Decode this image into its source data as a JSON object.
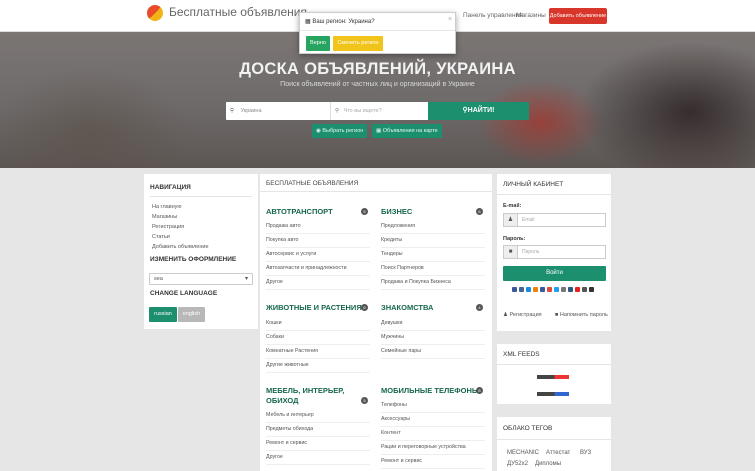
{
  "header": {
    "brand": "Бесплатные объявления",
    "links": [
      "Панель управления",
      "Магазины"
    ],
    "add_button": "Добавить объявление"
  },
  "hero": {
    "title": "ДОСКА ОБЪЯВЛЕНИЙ, УКРАИНА",
    "subtitle": "Поиск объявлений от частных лиц и организаций в Украине",
    "search": {
      "region_value": "Украина",
      "query_placeholder": "Что вы ищете?",
      "button": "НАЙТИ!"
    },
    "buttons": [
      "Выбрать регион",
      "Объявления на карте"
    ]
  },
  "modal": {
    "title": "Ваш регион: Украина?",
    "close": "×",
    "yes": "Верно",
    "change": "Сменить регион"
  },
  "sidebar": {
    "nav_title": "НАВИГАЦИЯ",
    "nav_items": [
      "На главную",
      "Магазины",
      "Регистрация",
      "Статьи",
      "Добавить объявление"
    ],
    "design_title": "ИЗМЕНИТЬ ОФОРМЛЕНИЕ",
    "design_select": "sea",
    "lang_title": "CHANGE LANGUAGE",
    "lang_buttons": [
      "russian",
      "english"
    ]
  },
  "main": {
    "title": "БЕСПЛАТНЫЕ ОБЪЯВЛЕНИЯ",
    "categories": [
      {
        "title": "АВТОТРАНСПОРТ",
        "count": "5",
        "subs": [
          "Продажа авто",
          "Покупка авто",
          "Автосервис и услуги",
          "Автозапчасти и принадлежности",
          "Другое"
        ]
      },
      {
        "title": "БИЗНЕС",
        "count": "6",
        "subs": [
          "Предложения",
          "Кредиты",
          "Тендеры",
          "Поиск Партнеров",
          "Продажа и Покупка Бизнеса"
        ]
      },
      {
        "title": "ЖИВОТНЫЕ И РАСТЕНИЯ",
        "count": "6",
        "subs": [
          "Кошки",
          "Собаки",
          "Комнатные Растения",
          "Другие животные"
        ]
      },
      {
        "title": "ЗНАКОМСТВА",
        "count": "4",
        "subs": [
          "Девушки",
          "Мужчины",
          "Семейные пары"
        ]
      },
      {
        "title": "МЕБЕЛЬ, ИНТЕРЬЕР,",
        "title2": "ОБИХОД",
        "count": "5",
        "subs": [
          "Мебель и интерьер",
          "Предметы обихода",
          "Ремонт и сервис",
          "Другое"
        ]
      },
      {
        "title": "МОБИЛЬНЫЕ ТЕЛЕФОНЫ",
        "count": "8",
        "subs": [
          "Телефоны",
          "Аксессуары",
          "Контент",
          "Рации и переговорные устройства",
          "Ремонт и сервис"
        ]
      }
    ]
  },
  "cabinet": {
    "title": "ЛИЧНЫЙ КАБИНЕТ",
    "email_label": "E-mail:",
    "email_placeholder": "Email",
    "password_label": "Пароль:",
    "password_placeholder": "Пароль",
    "login": "Войти",
    "register": "Регистрация",
    "forgot": "Напомнить пароль"
  },
  "xml": {
    "title": "XML FEEDS"
  },
  "tags": {
    "title": "ОБЛАКО ТЕГОВ",
    "items": [
      "MECHANIC",
      "Аттестат",
      "ВУЗ",
      "ДУ52х2",
      "Дипломы"
    ]
  },
  "colors": {
    "accent": "#1c8f6f",
    "danger": "#d9362b",
    "warning": "#f0c419",
    "success": "#26a560"
  }
}
